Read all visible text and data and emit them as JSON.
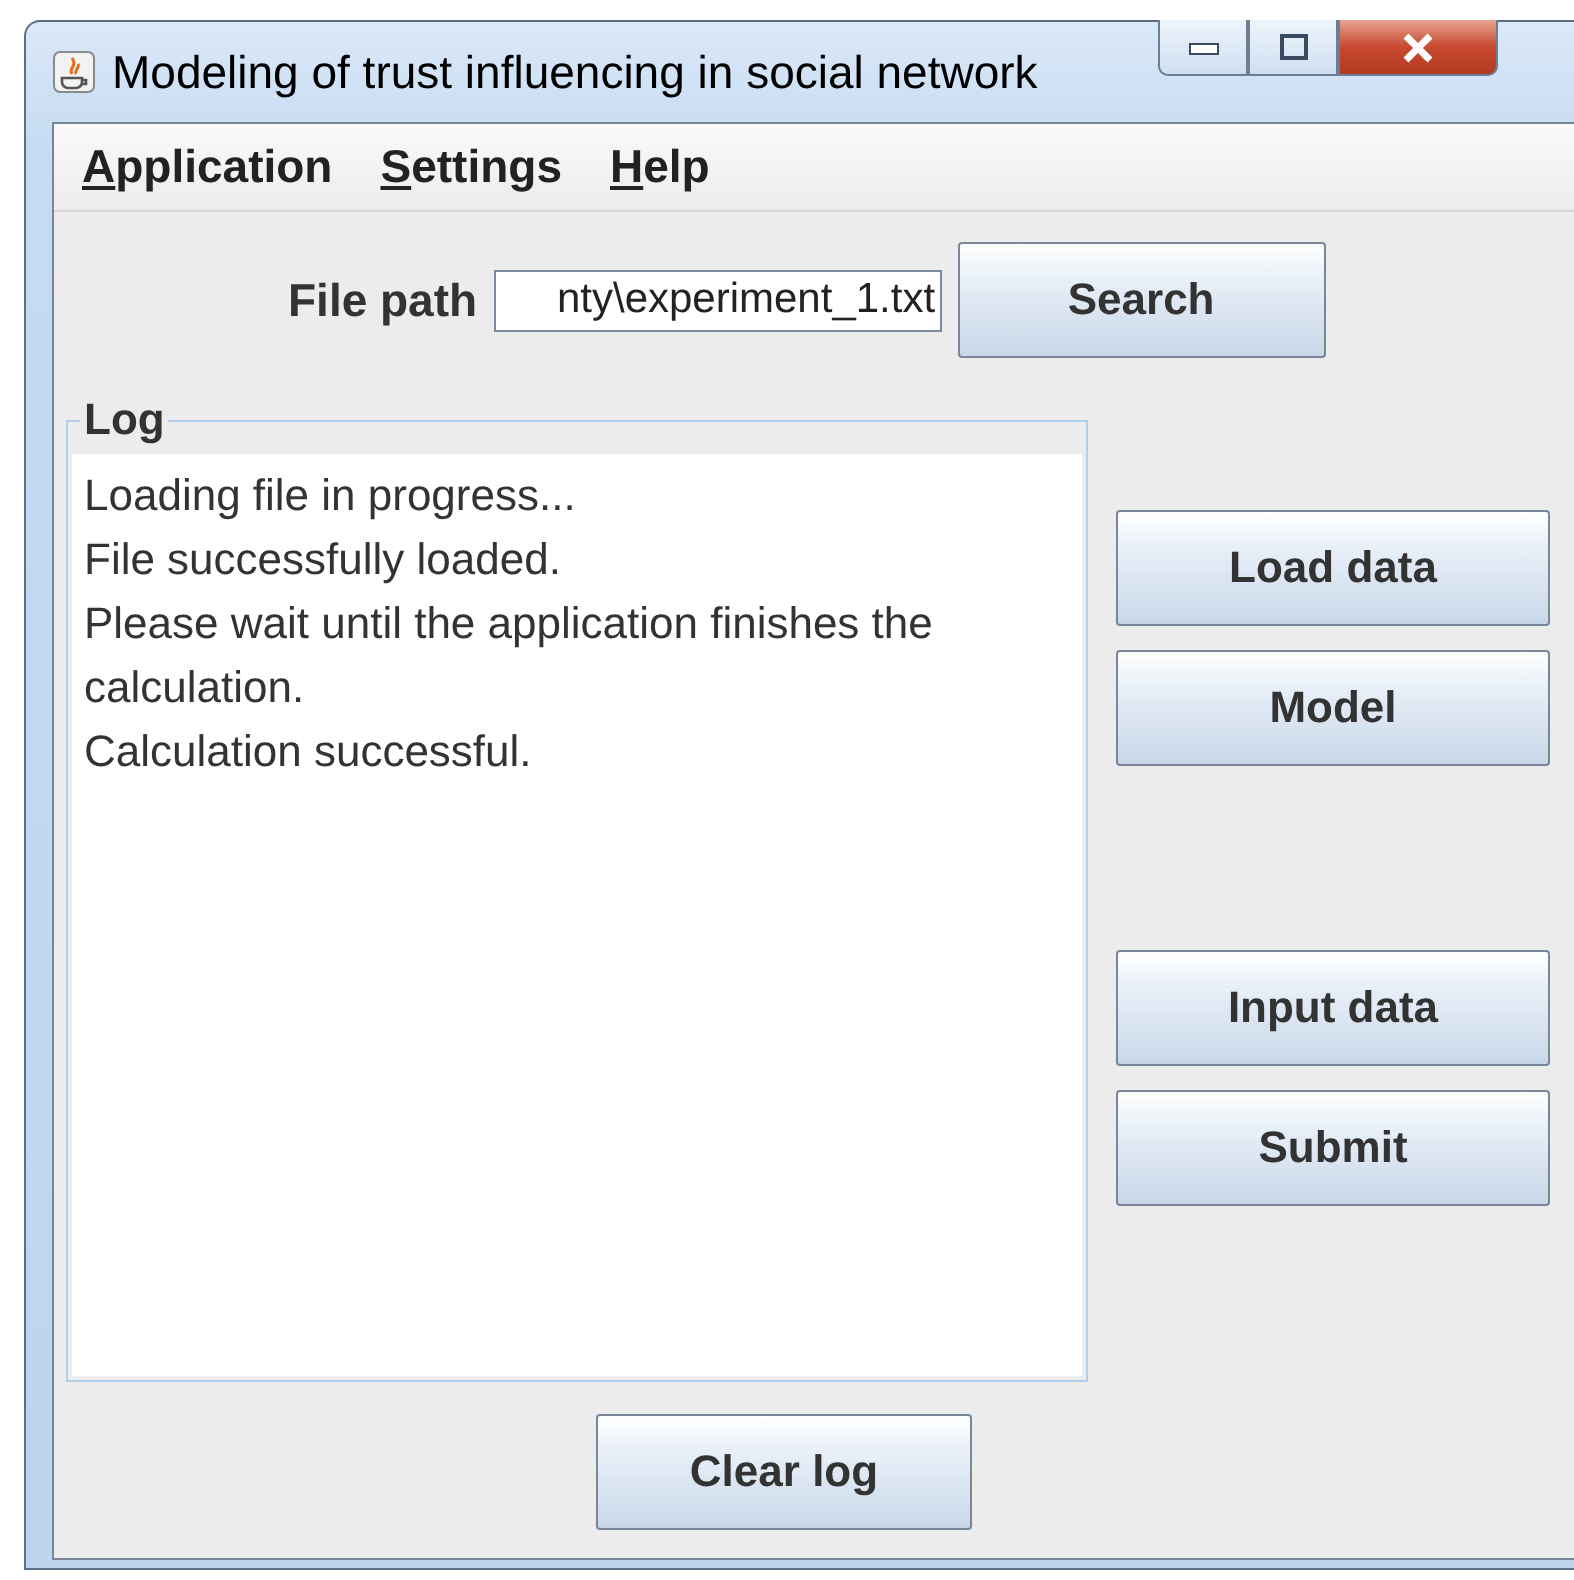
{
  "window": {
    "title": "Modeling of trust influencing in social network"
  },
  "menu": [
    "Application",
    "Settings",
    "Help"
  ],
  "file_path": {
    "label": "File path",
    "value": "nty\\experiment_1.txt"
  },
  "search_button": "Search",
  "log": {
    "title": "Log",
    "lines": [
      "Loading file in progress...",
      "File successfully loaded.",
      "Please wait until the application finishes the calculation.",
      "Calculation successful."
    ]
  },
  "side_buttons_top": [
    "Load data",
    "Model"
  ],
  "side_buttons_bottom": [
    "Input data",
    "Submit"
  ],
  "clear_button": "Clear log"
}
